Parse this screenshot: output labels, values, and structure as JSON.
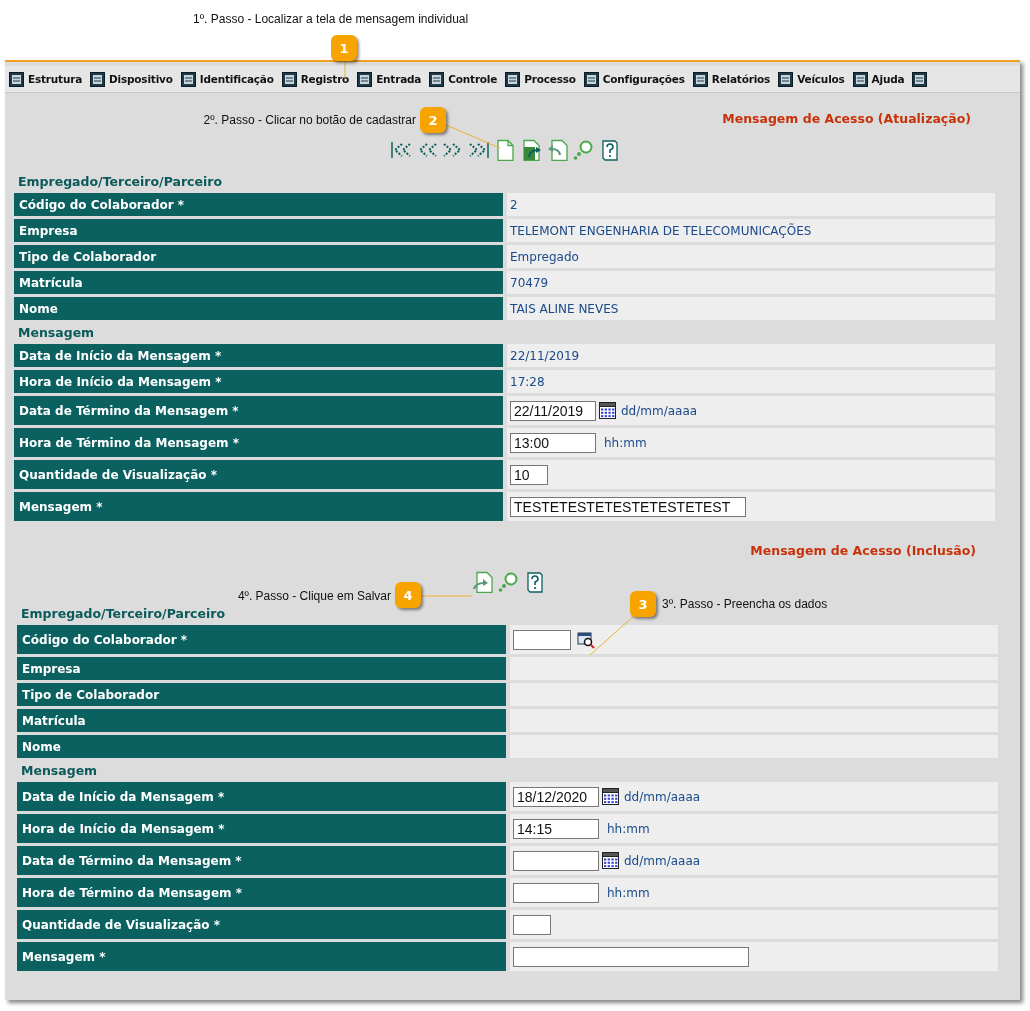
{
  "callouts": [
    {
      "number": "1",
      "text": "1º. Passo - Localizar a tela de mensagem individual"
    },
    {
      "number": "2",
      "text": "2º. Passo - Clicar no botão de cadastrar"
    },
    {
      "number": "3",
      "text": "3º. Passo - Preencha os dados"
    },
    {
      "number": "4",
      "text": "4º. Passo - Clique em Salvar"
    }
  ],
  "menu": {
    "items": [
      {
        "label": "Estrutura"
      },
      {
        "label": "Dispositivo"
      },
      {
        "label": "Identificação"
      },
      {
        "label": "Registro"
      },
      {
        "label": "Entrada"
      },
      {
        "label": "Controle"
      },
      {
        "label": "Processo"
      },
      {
        "label": "Configurações"
      },
      {
        "label": "Relatórios"
      },
      {
        "label": "Veículos"
      },
      {
        "label": "Ajuda"
      }
    ],
    "cut_item_icon": true
  },
  "forms": [
    {
      "title": "Mensagem de Acesso (Atualização)",
      "toolbar": [
        {
          "kind": "first"
        },
        {
          "kind": "prev"
        },
        {
          "kind": "next"
        },
        {
          "kind": "last"
        },
        {
          "kind": "new"
        },
        {
          "kind": "export"
        },
        {
          "kind": "back"
        },
        {
          "kind": "search"
        },
        {
          "kind": "help"
        }
      ],
      "sections": [
        {
          "heading": "Empregado/Terceiro/Parceiro",
          "rows": [
            {
              "label": "Código do Colaborador *",
              "kind": "text",
              "value": "2"
            },
            {
              "label": "Empresa",
              "kind": "text",
              "value": "TELEMONT ENGENHARIA DE TELECOMUNICAÇÕES"
            },
            {
              "label": "Tipo de Colaborador",
              "kind": "text",
              "value": "Empregado"
            },
            {
              "label": "Matrícula",
              "kind": "text",
              "value": "70479"
            },
            {
              "label": "Nome",
              "kind": "text",
              "value": "TAIS ALINE NEVES"
            }
          ]
        },
        {
          "heading": "Mensagem",
          "rows": [
            {
              "label": "Data de Início da Mensagem *",
              "kind": "text",
              "value": "22/11/2019"
            },
            {
              "label": "Hora de Início da Mensagem *",
              "kind": "text",
              "value": "17:28"
            },
            {
              "label": "Data de Término da Mensagem *",
              "kind": "date",
              "value": "22/11/2019",
              "hint": "dd/mm/aaaa"
            },
            {
              "label": "Hora de Término da Mensagem *",
              "kind": "time",
              "value": "13:00",
              "hint": "hh:mm"
            },
            {
              "label": "Quantidade de Visualização *",
              "kind": "number",
              "value": "10"
            },
            {
              "label": "Mensagem *",
              "kind": "message",
              "value": "TESTETESTETESTETESTETEST"
            }
          ]
        }
      ]
    },
    {
      "title": "Mensagem de Acesso (Inclusão)",
      "toolbar": [
        {
          "kind": "save"
        },
        {
          "kind": "search"
        },
        {
          "kind": "help"
        }
      ],
      "sections": [
        {
          "heading": "Empregado/Terceiro/Parceiro",
          "rows": [
            {
              "label": "Código do Colaborador *",
              "kind": "lookup"
            },
            {
              "label": "Empresa",
              "kind": "empty"
            },
            {
              "label": "Tipo de Colaborador",
              "kind": "empty"
            },
            {
              "label": "Matrícula",
              "kind": "empty"
            },
            {
              "label": "Nome",
              "kind": "empty"
            }
          ]
        },
        {
          "heading": "Mensagem",
          "rows": [
            {
              "label": "Data de Início da Mensagem *",
              "kind": "date",
              "value": "18/12/2020",
              "hint": "dd/mm/aaaa"
            },
            {
              "label": "Hora de Início da Mensagem *",
              "kind": "time",
              "value": "14:15",
              "hint": "hh:mm"
            },
            {
              "label": "Data de Término da Mensagem *",
              "kind": "date",
              "hint": "dd/mm/aaaa"
            },
            {
              "label": "Hora de Término da Mensagem *",
              "kind": "time",
              "hint": "hh:mm"
            },
            {
              "label": "Quantidade de Visualização *",
              "kind": "number"
            },
            {
              "label": "Mensagem *",
              "kind": "message"
            }
          ]
        }
      ]
    }
  ]
}
